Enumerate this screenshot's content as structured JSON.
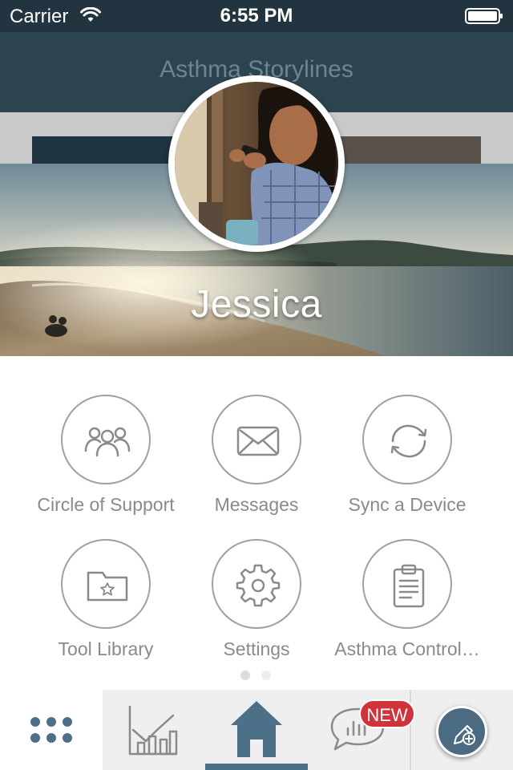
{
  "status_bar": {
    "carrier": "Carrier",
    "time": "6:55 PM"
  },
  "nav": {
    "title": "Asthma Storylines"
  },
  "profile": {
    "name": "Jessica"
  },
  "menu": [
    {
      "label": "Circle of Support",
      "icon": "people-icon"
    },
    {
      "label": "Messages",
      "icon": "envelope-icon"
    },
    {
      "label": "Sync a Device",
      "icon": "sync-icon"
    },
    {
      "label": "Tool Library",
      "icon": "folder-star-icon"
    },
    {
      "label": "Settings",
      "icon": "gear-icon"
    },
    {
      "label": "Asthma Control…",
      "icon": "clipboard-icon"
    }
  ],
  "pager": {
    "pages": 2,
    "current": 1
  },
  "tabs": [
    {
      "name": "menu",
      "icon": "dots-grid-icon",
      "active": false
    },
    {
      "name": "charts",
      "icon": "bar-chart-icon",
      "active": false
    },
    {
      "name": "home",
      "icon": "home-icon",
      "active": true
    },
    {
      "name": "feed",
      "icon": "chat-chart-icon",
      "active": false,
      "badge": "NEW"
    }
  ],
  "colors": {
    "accent": "#4d7089",
    "badge": "#d0343a",
    "nav": "#2c4350",
    "status_bar": "#22343f",
    "menu_outline": "#a0a0a0",
    "dot_active": "#dddddd",
    "dot_inactive": "#eeeeee"
  }
}
